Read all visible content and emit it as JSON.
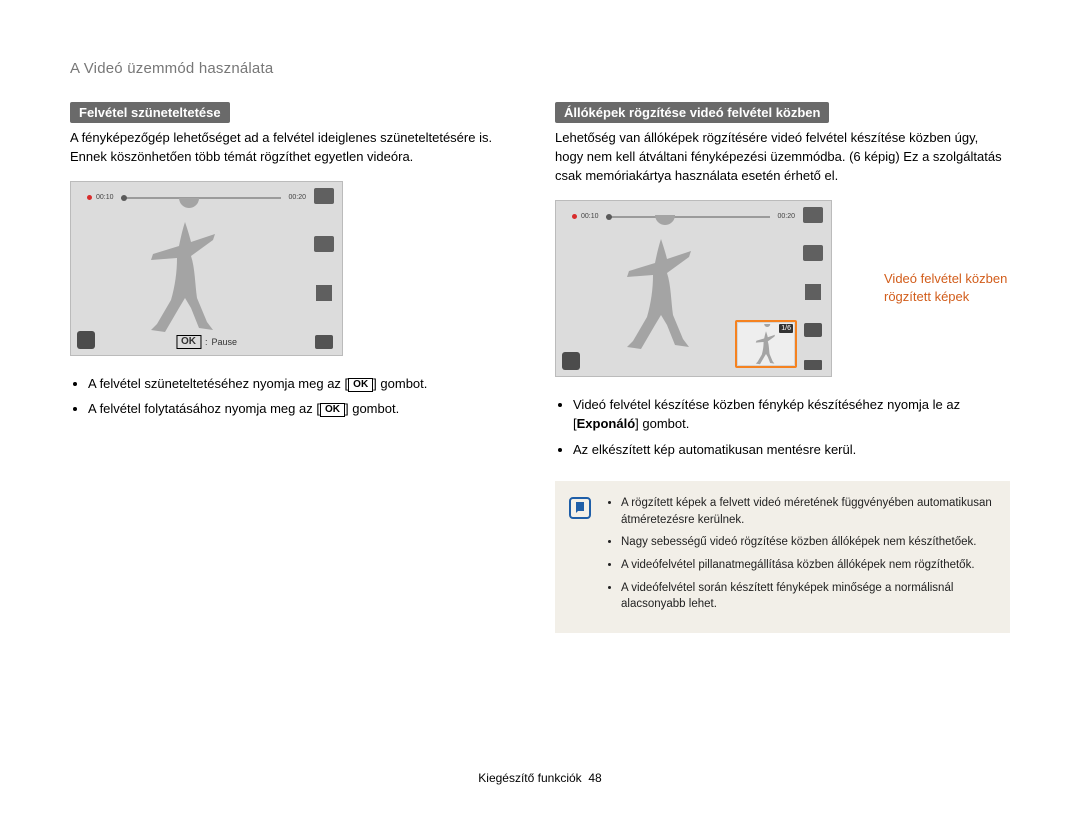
{
  "header": {
    "title": "A Videó üzemmód használata"
  },
  "left": {
    "label": "Felvétel szüneteltetése",
    "intro": "A fényképezőgép lehetőséget ad a felvétel ideiglenes szüneteltetésére is. Ennek köszönhetően több témát rögzíthet egyetlen videóra.",
    "lcd": {
      "time_elapsed": "00:10",
      "time_remain": "00:20",
      "ok_label": "OK",
      "pause_label": "Pause"
    },
    "bullet1_pre": "A felvétel szüneteltetéséhez nyomja meg az ",
    "bullet1_post": " gombot.",
    "ok_btn_text": "OK",
    "bullet2_pre": "A felvétel folytatásához nyomja meg az ",
    "bullet2_post": " gombot."
  },
  "right": {
    "label": "Állóképek rögzítése videó felvétel közben",
    "intro": "Lehetőség van állóképek rögzítésére videó felvétel készítése közben úgy, hogy nem kell átváltani fényképezési üzemmódba. (6 képig) Ez a szolgáltatás csak memóriakártya használata esetén érhető el.",
    "lcd": {
      "time_elapsed": "00:10",
      "time_remain": "00:20",
      "thumb_count": "1/6"
    },
    "callout": "Videó felvétel közben rögzített képek",
    "bullet1_pre": "Videó felvétel készítése közben fénykép készítéséhez nyomja le az [",
    "bullet1_bold": "Exponáló",
    "bullet1_post": "] gombot.",
    "bullet2": "Az elkészített kép automatikusan mentésre kerül.",
    "notes": {
      "items": [
        "A rögzített képek a felvett videó méretének függvényében automatikusan átméretezésre kerülnek.",
        "Nagy sebességű videó rögzítése közben állóképek nem készíthetőek.",
        "A videófelvétel pillanatmegállítása közben állóképek nem rögzíthetők.",
        "A videófelvétel során készített fényképek minősége a normálisnál alacsonyabb lehet."
      ]
    }
  },
  "footer": {
    "section": "Kiegészítő funkciók",
    "page": "48"
  }
}
